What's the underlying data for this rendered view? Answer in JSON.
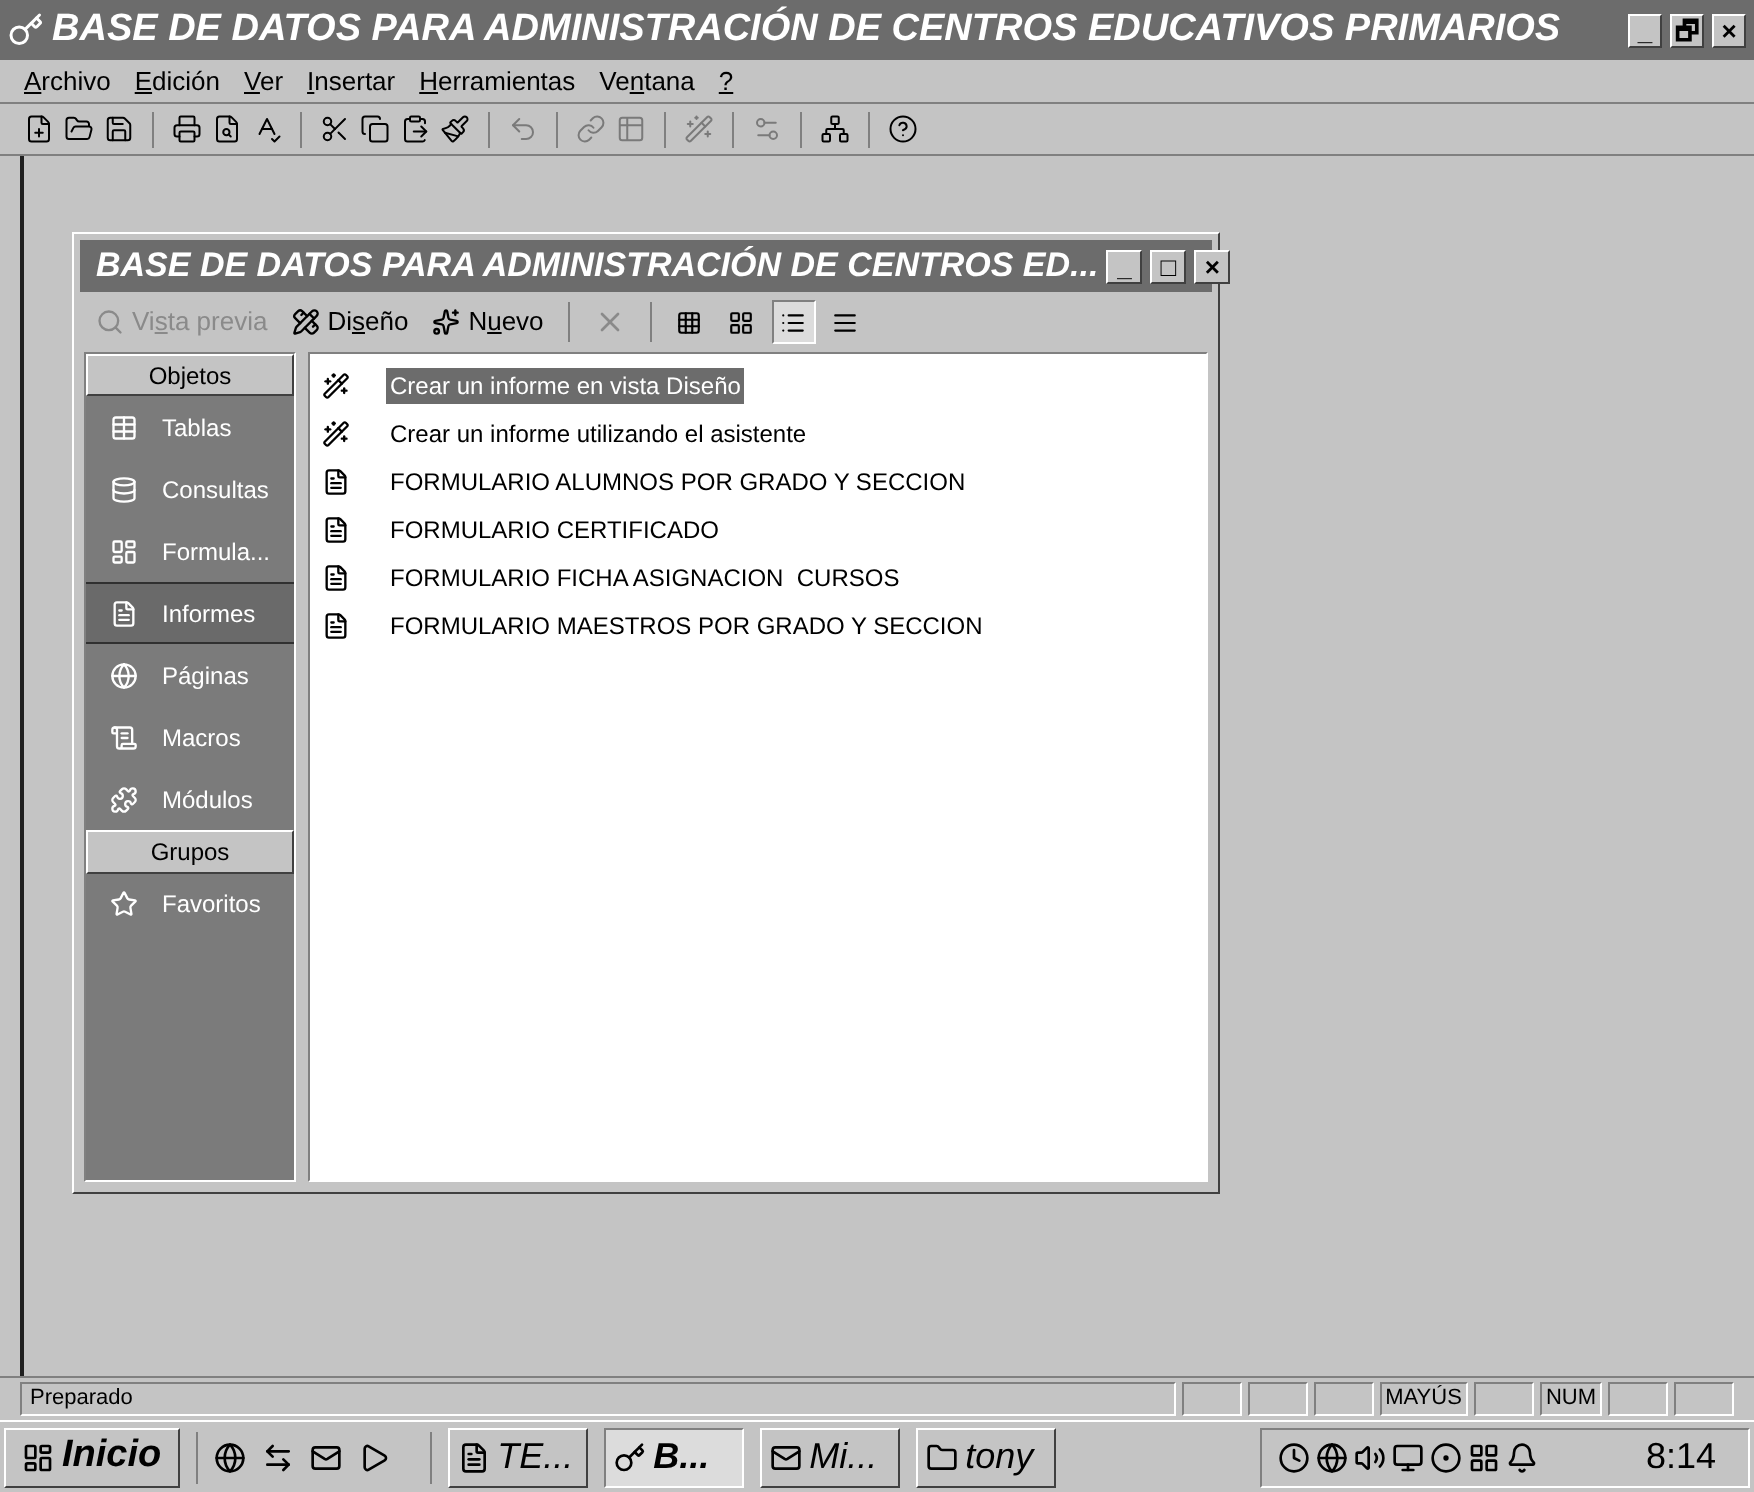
{
  "window": {
    "title": "BASE DE DATOS PARA ADMINISTRACIÓN DE CENTROS EDUCATIVOS PRIMARIOS",
    "controls": [
      "_",
      "🗗",
      "×"
    ]
  },
  "menu": [
    {
      "key": "A",
      "post": "rchivo"
    },
    {
      "key": "E",
      "post": "dición"
    },
    {
      "key": "V",
      "post": "er"
    },
    {
      "key": "I",
      "post": "nsertar"
    },
    {
      "key": "H",
      "post": "erramientas"
    },
    {
      "pre": "Ve",
      "key": "n",
      "post": "tana"
    },
    {
      "key": "?"
    }
  ],
  "db_window": {
    "title": "BASE DE DATOS PARA ADMINISTRACIÓN DE CENTROS ED...",
    "controls": [
      "_",
      "□",
      "×"
    ],
    "toolbar": [
      {
        "kind": "text",
        "pre": "Vi",
        "key": "s",
        "post": "ta previa",
        "disabled": true
      },
      {
        "kind": "text",
        "pre": "Di",
        "key": "s",
        "post": "eño",
        "disabled": false
      },
      {
        "kind": "text",
        "pre": "N",
        "key": "u",
        "post": "evo",
        "disabled": false
      },
      {
        "kind": "delete",
        "disabled": true
      },
      {
        "kind": "view",
        "selected": false
      },
      {
        "kind": "view",
        "selected": false
      },
      {
        "kind": "view",
        "selected": true
      },
      {
        "kind": "view",
        "selected": false
      }
    ],
    "objects_header": "Objetos",
    "objects": [
      {
        "label": "Tablas",
        "selected": false
      },
      {
        "label": "Consultas",
        "selected": false
      },
      {
        "label": "Formula...",
        "selected": false
      },
      {
        "label": "Informes",
        "selected": true
      },
      {
        "label": "Páginas",
        "selected": false
      },
      {
        "label": "Macros",
        "selected": false
      },
      {
        "label": "Módulos",
        "selected": false
      }
    ],
    "groups_header": "Grupos",
    "groups": [
      {
        "label": "Favoritos",
        "selected": false
      }
    ],
    "items": [
      {
        "label": "Crear un informe en vista Diseño",
        "kind": "shortcut",
        "selected": true
      },
      {
        "label": "Crear un informe utilizando el asistente",
        "kind": "shortcut",
        "selected": false
      },
      {
        "label": "FORMULARIO ALUMNOS POR GRADO Y SECCION",
        "kind": "report",
        "selected": false
      },
      {
        "label": "FORMULARIO CERTIFICADO",
        "kind": "report",
        "selected": false
      },
      {
        "label": "FORMULARIO FICHA ASIGNACION  CURSOS",
        "kind": "report",
        "selected": false
      },
      {
        "label": "FORMULARIO MAESTROS POR GRADO Y SECCION",
        "kind": "report",
        "selected": false
      }
    ]
  },
  "status_bar": {
    "text": "Preparado",
    "caps": "MAYÚS",
    "num": "NUM"
  },
  "taskbar": {
    "start": "Inicio",
    "tasks": [
      {
        "label": "TE...",
        "selected": false
      },
      {
        "label": "B...",
        "selected": true
      },
      {
        "label": "Mi...",
        "selected": false
      },
      {
        "label": "tony",
        "selected": false
      }
    ],
    "clock": "8:14"
  }
}
